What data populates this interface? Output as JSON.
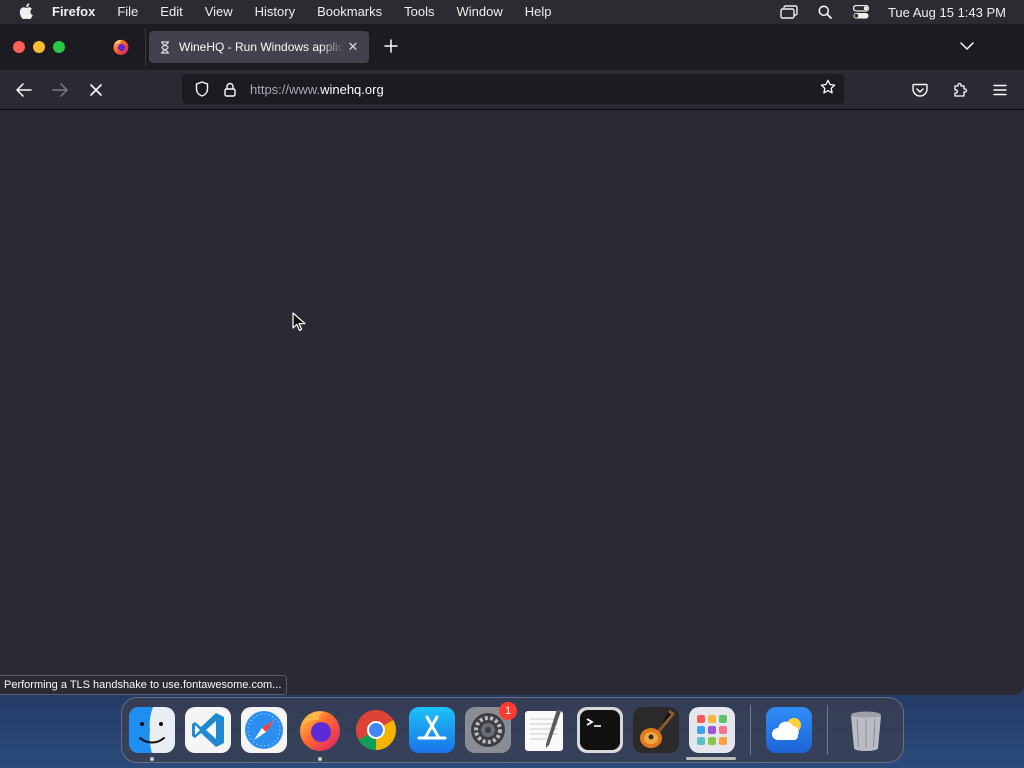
{
  "menubar": {
    "app_name": "Firefox",
    "items": [
      "File",
      "Edit",
      "View",
      "History",
      "Bookmarks",
      "Tools",
      "Window",
      "Help"
    ],
    "clock": "Tue Aug 15  1:43 PM"
  },
  "tabs": {
    "active_title": "WineHQ - Run Windows applications on Linux, BSD, Solaris and macOS",
    "active_favicon": "hourglass-loading-icon"
  },
  "navbar": {
    "url_prefix": "https://www.",
    "url_domain": "winehq.org",
    "url_full": "https://www.winehq.org"
  },
  "status_text": "Performing a TLS handshake to use.fontawesome.com...",
  "dock": {
    "apps": [
      {
        "name": "Finder",
        "icon": "finder-icon"
      },
      {
        "name": "Visual Studio Code",
        "icon": "vscode-icon"
      },
      {
        "name": "Safari",
        "icon": "safari-icon"
      },
      {
        "name": "Firefox",
        "icon": "firefox-icon"
      },
      {
        "name": "Google Chrome",
        "icon": "chrome-icon"
      },
      {
        "name": "App Store",
        "icon": "app-store-icon"
      },
      {
        "name": "System Settings",
        "icon": "system-settings-icon",
        "badge": "1"
      },
      {
        "name": "TextEdit",
        "icon": "textedit-icon"
      },
      {
        "name": "Terminal",
        "icon": "terminal-icon"
      },
      {
        "name": "GarageBand",
        "icon": "garageband-icon"
      },
      {
        "name": "Launchpad",
        "icon": "launchpad-icon"
      },
      {
        "name": "Weather",
        "icon": "weather-icon"
      },
      {
        "name": "Trash",
        "icon": "trash-icon"
      }
    ]
  },
  "colors": {
    "toolbar": "#2b2a33",
    "tabstrip": "#1c1b22",
    "active_tab": "#42414d",
    "text": "#fbfbfe"
  }
}
